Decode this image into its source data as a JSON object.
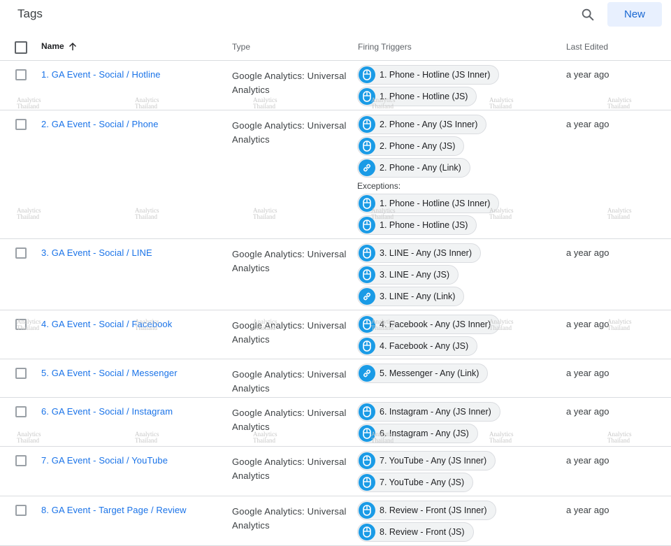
{
  "header": {
    "title": "Tags",
    "new_label": "New",
    "search_icon": "search-icon"
  },
  "columns": {
    "name": "Name",
    "name_sort_icon": "arrow-up-icon",
    "type": "Type",
    "firing_triggers": "Firing Triggers",
    "last_edited": "Last Edited"
  },
  "exceptions_label": "Exceptions:",
  "watermark": "Analytics Thailand",
  "tags": [
    {
      "name": "1. GA Event - Social / Hotline",
      "type": "Google Analytics: Universal Analytics",
      "last_edited": "a year ago",
      "triggers": [
        {
          "label": "1. Phone - Hotline (JS Inner)",
          "icon": "mouse-icon"
        },
        {
          "label": "1. Phone - Hotline (JS)",
          "icon": "mouse-icon"
        }
      ],
      "exceptions": []
    },
    {
      "name": "2. GA Event - Social / Phone",
      "type": "Google Analytics: Universal Analytics",
      "last_edited": "a year ago",
      "triggers": [
        {
          "label": "2. Phone - Any (JS Inner)",
          "icon": "mouse-icon"
        },
        {
          "label": "2. Phone - Any (JS)",
          "icon": "mouse-icon"
        },
        {
          "label": "2. Phone - Any (Link)",
          "icon": "link-icon"
        }
      ],
      "exceptions": [
        {
          "label": "1. Phone - Hotline (JS Inner)",
          "icon": "mouse-icon"
        },
        {
          "label": "1. Phone - Hotline (JS)",
          "icon": "mouse-icon"
        }
      ]
    },
    {
      "name": "3. GA Event - Social / LINE",
      "type": "Google Analytics: Universal Analytics",
      "last_edited": "a year ago",
      "triggers": [
        {
          "label": "3. LINE - Any (JS Inner)",
          "icon": "mouse-icon"
        },
        {
          "label": "3. LINE - Any (JS)",
          "icon": "mouse-icon"
        },
        {
          "label": "3. LINE - Any (Link)",
          "icon": "link-icon"
        }
      ],
      "exceptions": []
    },
    {
      "name": "4. GA Event - Social / Facebook",
      "type": "Google Analytics: Universal Analytics",
      "last_edited": "a year ago",
      "triggers": [
        {
          "label": "4. Facebook - Any (JS Inner)",
          "icon": "mouse-icon"
        },
        {
          "label": "4. Facebook - Any (JS)",
          "icon": "mouse-icon"
        }
      ],
      "exceptions": []
    },
    {
      "name": "5. GA Event - Social / Messenger",
      "type": "Google Analytics: Universal Analytics",
      "last_edited": "a year ago",
      "triggers": [
        {
          "label": "5. Messenger - Any (Link)",
          "icon": "link-icon"
        }
      ],
      "exceptions": []
    },
    {
      "name": "6. GA Event - Social / Instagram",
      "type": "Google Analytics: Universal Analytics",
      "last_edited": "a year ago",
      "triggers": [
        {
          "label": "6. Instagram - Any (JS Inner)",
          "icon": "mouse-icon"
        },
        {
          "label": "6. Instagram - Any (JS)",
          "icon": "mouse-icon"
        }
      ],
      "exceptions": []
    },
    {
      "name": "7. GA Event - Social / YouTube",
      "type": "Google Analytics: Universal Analytics",
      "last_edited": "a year ago",
      "triggers": [
        {
          "label": "7. YouTube - Any (JS Inner)",
          "icon": "mouse-icon"
        },
        {
          "label": "7. YouTube - Any (JS)",
          "icon": "mouse-icon"
        }
      ],
      "exceptions": []
    },
    {
      "name": "8. GA Event - Target Page / Review",
      "type": "Google Analytics: Universal Analytics",
      "last_edited": "a year ago",
      "triggers": [
        {
          "label": "8. Review - Front (JS Inner)",
          "icon": "mouse-icon"
        },
        {
          "label": "8. Review - Front (JS)",
          "icon": "mouse-icon"
        }
      ],
      "exceptions": []
    }
  ]
}
